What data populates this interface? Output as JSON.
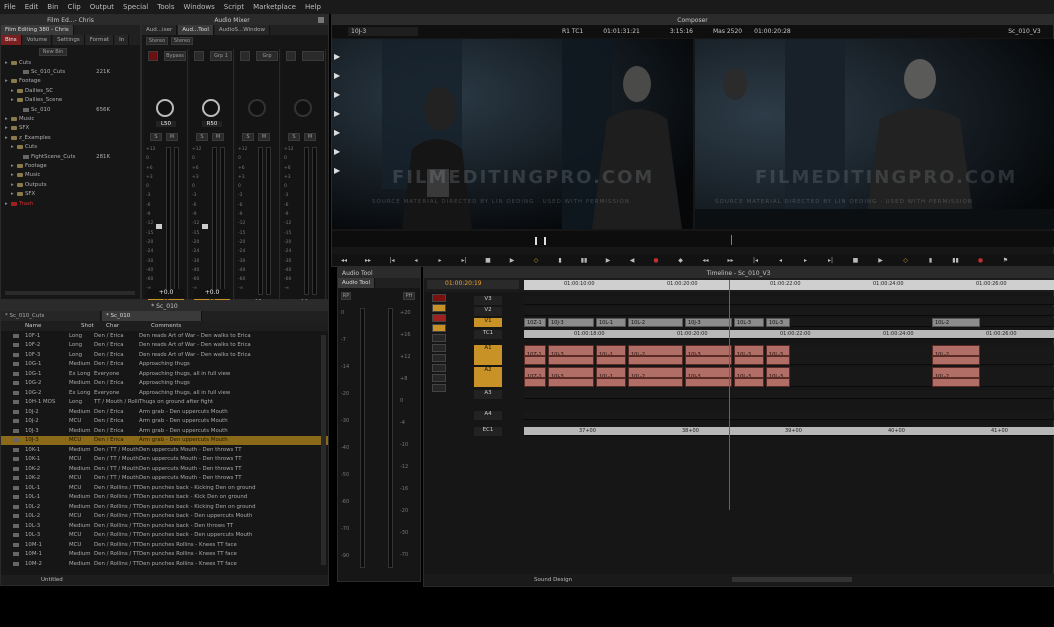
{
  "menu": [
    "File",
    "Edit",
    "Bin",
    "Clip",
    "Output",
    "Special",
    "Tools",
    "Windows",
    "Script",
    "Marketplace",
    "Help"
  ],
  "project": {
    "title": "Film Ed...- Chris",
    "tabs": [
      "Film Editing 380 - Chris",
      "Bins",
      "Volume",
      "Settings",
      "Format",
      "In"
    ],
    "new_bin": "New Bin",
    "tree": [
      {
        "label": "Cuts",
        "indent": 0,
        "type": "bin"
      },
      {
        "label": "Sc_010_Cuts",
        "indent": 2,
        "type": "clip",
        "size": "221K"
      },
      {
        "label": "Footage",
        "indent": 0,
        "type": "bin"
      },
      {
        "label": "Dailies_SC",
        "indent": 1,
        "type": "bin"
      },
      {
        "label": "Dailies_Scene",
        "indent": 1,
        "type": "bin"
      },
      {
        "label": "Sc_010",
        "indent": 2,
        "type": "clip",
        "size": "656K"
      },
      {
        "label": "Music",
        "indent": 0,
        "type": "bin"
      },
      {
        "label": "SFX",
        "indent": 0,
        "type": "bin"
      },
      {
        "label": "z_Examples",
        "indent": 0,
        "type": "bin"
      },
      {
        "label": "Cuts",
        "indent": 1,
        "type": "bin"
      },
      {
        "label": "FightScene_Cuts",
        "indent": 2,
        "type": "clip",
        "size": "281K"
      },
      {
        "label": "Footage",
        "indent": 1,
        "type": "bin"
      },
      {
        "label": "Music",
        "indent": 1,
        "type": "bin"
      },
      {
        "label": "Outputs",
        "indent": 1,
        "type": "bin"
      },
      {
        "label": "SFX",
        "indent": 1,
        "type": "bin"
      },
      {
        "label": "Trash",
        "indent": 0,
        "type": "trash"
      }
    ]
  },
  "mixer": {
    "title": "Audio Mixer",
    "tabs": [
      "Aud...ixer",
      "Aud...Tool",
      "AudioS...Window"
    ],
    "stereo": "Stereo",
    "bypass": "Bypass",
    "group": "Grp 1",
    "solo": "Grp",
    "channels": [
      {
        "name": "A1",
        "pan": "L50",
        "gain": "+0.0"
      },
      {
        "name": "A2",
        "pan": "R50",
        "gain": "+0.0"
      },
      {
        "name": "A3",
        "pan": "",
        "gain": ""
      },
      {
        "name": "A4",
        "pan": "",
        "gain": ""
      }
    ],
    "scale": [
      "+12",
      "0",
      "+6",
      "+3",
      "0",
      "-3",
      "-6",
      "-9",
      "-12",
      "-15",
      "-20",
      "-24",
      "-30",
      "-40",
      "-60",
      "-∞"
    ]
  },
  "composer": {
    "title": "Composer",
    "left_clip": "10J-3",
    "r1": "R1 TC1",
    "tc1": "01:01:31:21",
    "dur": "3:15:16",
    "mas": "Mas 2520",
    "tc2": "01:00:20:28",
    "right_seq": "Sc_010_V3",
    "watermark": "FILMEDITINGPRO.COM",
    "caption": "SOURCE MATERIAL DIRECTED BY LIN OEDING · USED WITH PERMISSION"
  },
  "audiotool": {
    "title": "Audio Tool",
    "tab": "Audio Tool",
    "labels": [
      "RP",
      "PH"
    ],
    "scale_l": [
      "0",
      "-7",
      "-14",
      "-20",
      "-30",
      "-40",
      "-50",
      "-60",
      "-70",
      "-90"
    ],
    "scale_r": [
      "+20",
      "+16",
      "+12",
      "+8",
      "0",
      "-4",
      "-10",
      "-12",
      "-16",
      "-20",
      "-30",
      "-70"
    ]
  },
  "timeline": {
    "title": "Timeline - Sc_010_V3",
    "timecode": "01:00:20:19",
    "ruler": [
      "01:00:10:00",
      "01:00:20:00",
      "01:00:22:00",
      "01:00:24:00",
      "01:00:26:00"
    ],
    "ruler2": [
      "01:00:18:00",
      "01:00:20:00",
      "01:00:22:00",
      "01:00:24:00",
      "01:00:26:00"
    ],
    "tracks": [
      "V3",
      "V2",
      "V1",
      "TC1",
      "A1",
      "A2",
      "A3",
      "A4",
      "EC1"
    ],
    "v1_clips": [
      "10Z-1",
      "10J-3",
      "10L-1",
      "10L-2",
      "10J-3",
      "10L-3",
      "10L-3",
      "10L-2"
    ],
    "a1_clips": [
      "10Z-1",
      "10J-3",
      "10L-1",
      "10L-2",
      "10J-3",
      "10L-3",
      "10L-3",
      "10L-2"
    ],
    "a2_clips": [
      "10Z-1",
      "10J-3",
      "10L-1",
      "10L-2",
      "10J-3",
      "10L-3",
      "10L-3",
      "10L-2"
    ],
    "ec": [
      "37+00",
      "38+00",
      "39+00",
      "40+00",
      "41+00"
    ],
    "bottom_label": "Sound Design"
  },
  "bin": {
    "tabs": [
      "* Sc_010_Cuts",
      "* Sc_010"
    ],
    "window_title": "* Sc_010",
    "columns": [
      "Name",
      "Shot",
      "Char",
      "Comments"
    ],
    "rows": [
      [
        "10F-1",
        "Long",
        "Den / Erica",
        "Den reads Art of War - Den walks to Erica"
      ],
      [
        "10F-2",
        "Long",
        "Den / Erica",
        "Den reads Art of War - Den walks to Erica"
      ],
      [
        "10F-3",
        "Long",
        "Den / Erica",
        "Den reads Art of War - Den walks to Erica"
      ],
      [
        "10G-1",
        "Medium",
        "Den / Erica",
        "Approaching thugs"
      ],
      [
        "10G-1",
        "Ex Long",
        "Everyone",
        "Approaching thugs, all in full view"
      ],
      [
        "10G-2",
        "Medium",
        "Den / Erica",
        "Approaching thugs"
      ],
      [
        "10G-2",
        "Ex Long",
        "Everyone",
        "Approaching thugs, all in full view"
      ],
      [
        "10H-1 MOS",
        "Long",
        "TT / Mouth / Rollins",
        "Thugs on ground after fight"
      ],
      [
        "10J-2",
        "Medium",
        "Den / Erica",
        "Arm grab - Den uppercuts Mouth"
      ],
      [
        "10J-2",
        "MCU",
        "Den / Erica",
        "Arm grab - Den uppercuts Mouth"
      ],
      [
        "10J-3",
        "Medium",
        "Den / Erica",
        "Arm grab - Den uppercuts Mouth"
      ],
      [
        "10J-3",
        "MCU",
        "Den / Erica",
        "Arm grab - Den uppercuts Mouth"
      ],
      [
        "10K-1",
        "Medium",
        "Den / TT / Mouth",
        "Den uppercuts Mouth - Den throws TT"
      ],
      [
        "10K-1",
        "MCU",
        "Den / TT / Mouth",
        "Den uppercuts Mouth - Den throws TT"
      ],
      [
        "10K-2",
        "Medium",
        "Den / TT / Mouth",
        "Den uppercuts Mouth - Den throws TT"
      ],
      [
        "10K-2",
        "MCU",
        "Den / TT / Mouth",
        "Den uppercuts Mouth - Den throws TT"
      ],
      [
        "10L-1",
        "MCU",
        "Den / Rollins / TT",
        "Den punches back - Kicking Den on ground"
      ],
      [
        "10L-1",
        "Medium",
        "Den / Rollins / TT",
        "Den punches back - Kick Den on ground"
      ],
      [
        "10L-2",
        "Medium",
        "Den / Rollins / TT",
        "Den punches back - Kicking Den on ground"
      ],
      [
        "10L-2",
        "MCU",
        "Den / Rollins / TT",
        "Den punches back - Den uppercuts Mouth"
      ],
      [
        "10L-3",
        "Medium",
        "Den / Rollins / TT",
        "Den punches back - Den throws TT"
      ],
      [
        "10L-3",
        "MCU",
        "Den / Rollins / TT",
        "Den punches back - Den uppercuts Mouth"
      ],
      [
        "10M-1",
        "MCU",
        "Den / Rollins / TT",
        "Den punches Rollins - Knees TT face"
      ],
      [
        "10M-1",
        "Medium",
        "Den / Rollins / TT",
        "Den punches Rollins - Knees TT face"
      ],
      [
        "10M-2",
        "Medium",
        "Den / Rollins / TT",
        "Den punches Rollins - Knees TT face"
      ]
    ],
    "selected": 11,
    "footer": "Untitled"
  }
}
